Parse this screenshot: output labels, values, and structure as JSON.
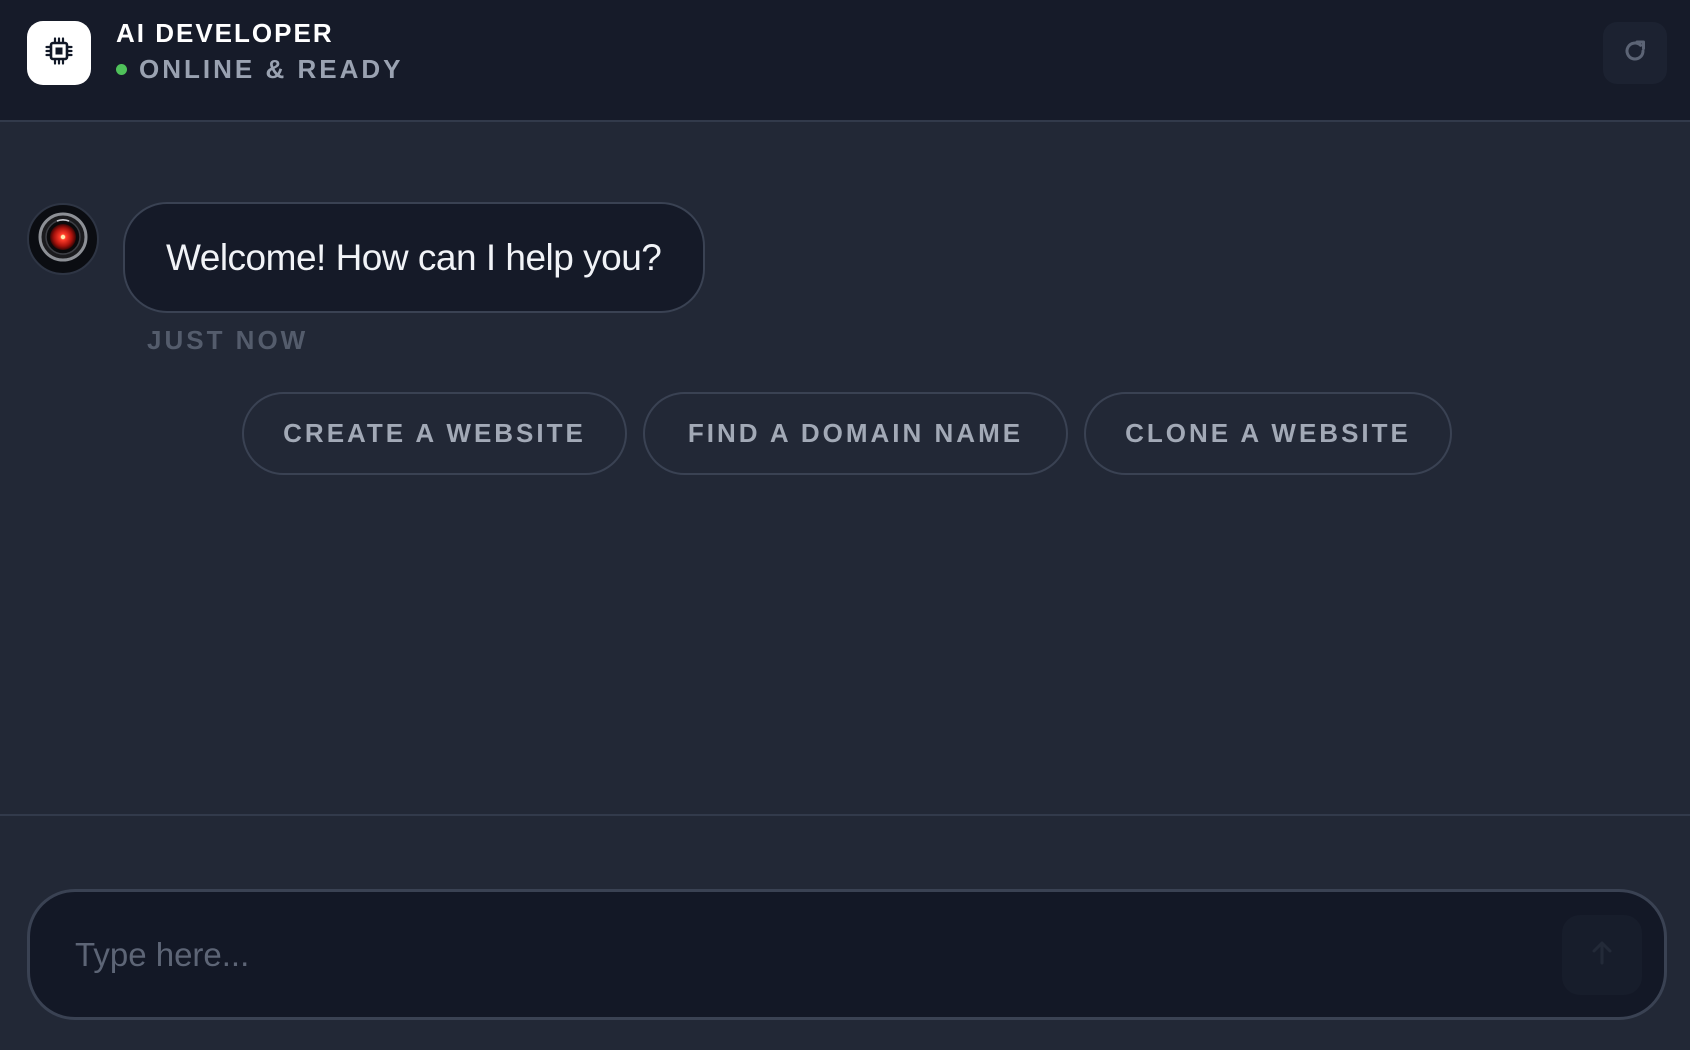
{
  "header": {
    "title": "AI DEVELOPER",
    "status": "ONLINE & READY",
    "status_color": "#4fc25a",
    "logo_icon": "chip-icon",
    "refresh_icon": "refresh-icon"
  },
  "chat": {
    "messages": [
      {
        "sender": "assistant",
        "avatar_icon": "robot-eye-icon",
        "text": "Welcome! How can I help you?",
        "time": "JUST NOW"
      }
    ],
    "suggestions": [
      "CREATE A WEBSITE",
      "FIND A DOMAIN NAME",
      "CLONE A WEBSITE"
    ]
  },
  "composer": {
    "placeholder": "Type here...",
    "value": "",
    "send_icon": "arrow-up-icon"
  },
  "colors": {
    "background": "#222836",
    "header_background": "#161b29",
    "bubble_background": "#151a28",
    "border": "#3a4253"
  }
}
